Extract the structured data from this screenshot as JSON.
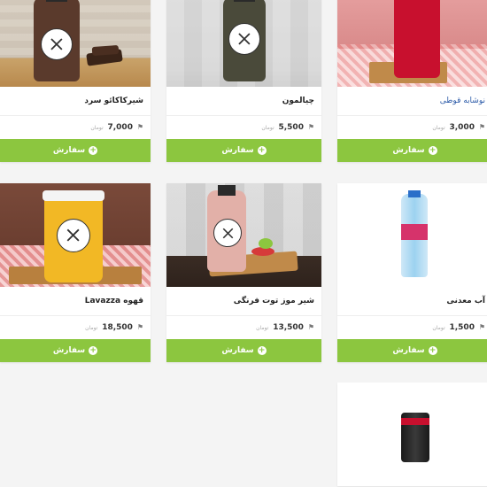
{
  "products": [
    {
      "name": "شیرکاکائو سرد",
      "price": "7,000",
      "currency": "تومان",
      "button": "سفارش"
    },
    {
      "name": "چیالمون",
      "price": "5,500",
      "currency": "تومان",
      "button": "سفارش"
    },
    {
      "name": "نوشابه قوطی",
      "price": "3,000",
      "currency": "تومان",
      "button": "سفارش"
    },
    {
      "name": "قهوه Lavazza",
      "price": "18,500",
      "currency": "تومان",
      "button": "سفارش"
    },
    {
      "name": "شیر موز توت فرنگی",
      "price": "13,500",
      "currency": "تومان",
      "button": "سفارش"
    },
    {
      "name": "آب معدنی",
      "price": "1,500",
      "currency": "تومان",
      "button": "سفارش"
    }
  ],
  "icons": {
    "price": "tag-icon",
    "order": "plus-circle-icon"
  },
  "colors": {
    "order_button": "#8cc63f",
    "link_name": "#2b5aa8"
  }
}
